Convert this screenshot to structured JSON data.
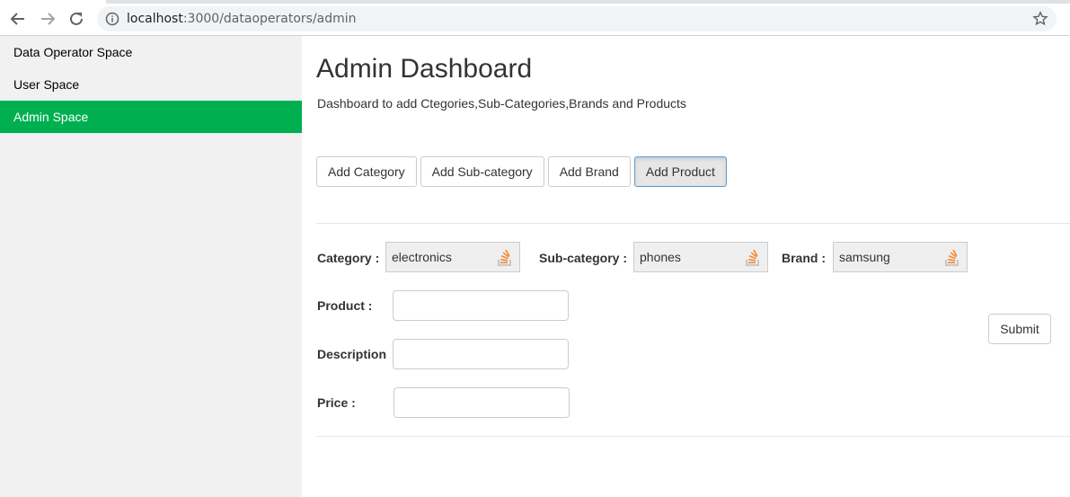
{
  "browser": {
    "url_host": "localhost",
    "url_path": ":3000/dataoperators/admin"
  },
  "sidebar": {
    "items": [
      {
        "label": "Data Operator Space"
      },
      {
        "label": "User Space"
      },
      {
        "label": "Admin Space"
      }
    ],
    "active_color": "#00b050"
  },
  "main": {
    "title": "Admin Dashboard",
    "subtitle": "Dashboard to add Ctegories,Sub-Categories,Brands and Products",
    "tabs": [
      {
        "label": "Add Category"
      },
      {
        "label": "Add Sub-category"
      },
      {
        "label": "Add Brand"
      },
      {
        "label": "Add Product"
      }
    ],
    "form": {
      "category_label": "Category :",
      "category_value": "electronics",
      "subcategory_label": "Sub-category :",
      "subcategory_value": "phones",
      "brand_label": "Brand :",
      "brand_value": "samsung",
      "product_label": "Product :",
      "product_value": "",
      "description_label": "Description",
      "description_value": "",
      "price_label": "Price :",
      "price_value": "",
      "submit_label": "Submit"
    }
  },
  "icons": {
    "back": "arrow-left-icon",
    "forward": "arrow-right-icon",
    "reload": "reload-icon",
    "info": "info-icon",
    "bookmark": "star-icon",
    "select": "stack-icon"
  }
}
